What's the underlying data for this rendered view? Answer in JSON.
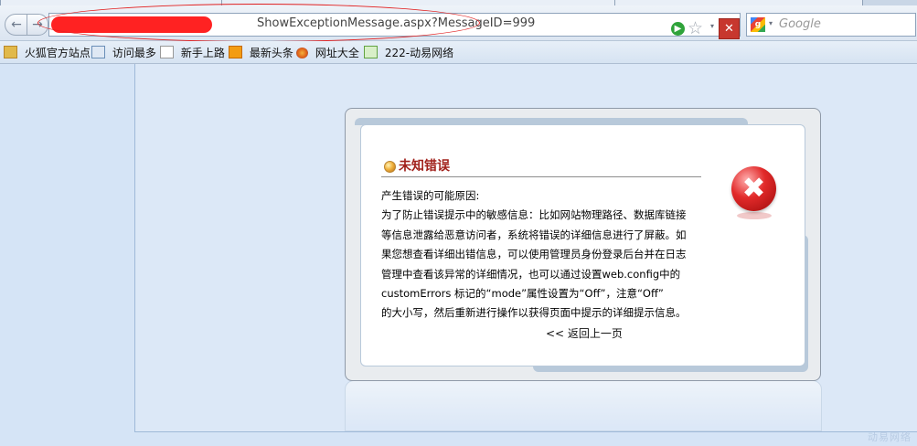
{
  "browser": {
    "back_label": "←",
    "forward_label": "→",
    "url_visible": "ShowExceptionMessage.aspx?MessageID=999",
    "search_placeholder": "Google",
    "google_label": "g",
    "star_label": "☆",
    "stop_label": "✕",
    "go_label": "▶",
    "dropdown_label": "▾"
  },
  "bookmarks": [
    {
      "label": "火狐官方站点",
      "icon": "folder-icon"
    },
    {
      "label": "访问最多",
      "icon": "search-page-icon"
    },
    {
      "label": "新手上路",
      "icon": "page-icon"
    },
    {
      "label": "最新头条",
      "icon": "rss-icon"
    },
    {
      "label": "网址大全",
      "icon": "firefox-icon"
    },
    {
      "label": "222-动易网络",
      "icon": "edit-page-icon"
    }
  ],
  "error": {
    "title": "未知错误",
    "lines": [
      "产生错误的可能原因:",
      "为了防止错误提示中的敏感信息：比如网站物理路径、数据库链接",
      "等信息泄露给恶意访问者，系统将错误的详细信息进行了屏蔽。如",
      "果您想查看详细出错信息，可以使用管理员身份登录后台并在日志",
      "管理中查看该异常的详细情况，也可以通过设置web.config中的",
      "customErrors 标记的“mode”属性设置为“Off”，注意“Off”",
      "的大小写，然后重新进行操作以获得页面中提示的详细提示信息。"
    ],
    "back_link": "<< 返回上一页",
    "icon_label": "✖"
  },
  "watermark": "动易网络",
  "colors": {
    "title": "#a1211b",
    "page_bg": "#d5e4f6",
    "error_icon": "#e22a2a"
  }
}
